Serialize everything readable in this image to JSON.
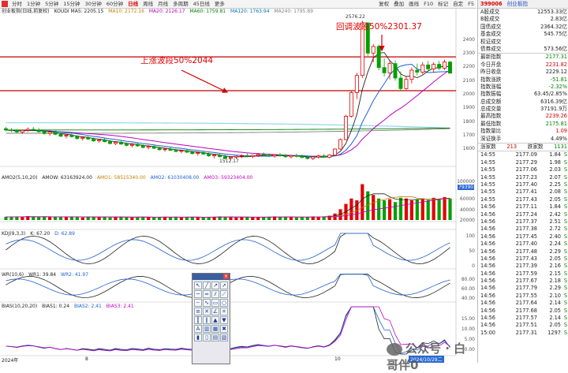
{
  "toolbar": {
    "periods": [
      "分时",
      "1分钟",
      "5分钟",
      "15分钟",
      "30分钟",
      "60分钟",
      "日线",
      "周线",
      "月线",
      "多周期",
      "45日线",
      "更多"
    ],
    "active_index": 6,
    "tools": [
      "复权",
      "叠加",
      "画线",
      "F10",
      "标记",
      "-",
      "自定",
      "F5"
    ],
    "f10": "F10"
  },
  "main_legend": {
    "title": "创业板指(日线,前复权)",
    "ma_header": "KOUDI MA5: 2205.15",
    "ma10": "MA10: 2172.16",
    "ma20": "MA20: 2126.17",
    "ma60": "MA60: 1759.81",
    "ma120": "MA120: 1763.94",
    "ma240": "MA240: 1795.89"
  },
  "annotations": {
    "up_wave": "上涨波段50%2044",
    "pullback": "回调波段50%2301.37",
    "high_label": "2576.22",
    "low_label": "1512.17"
  },
  "main_axis": [
    "2400",
    "2300",
    "2200",
    "2100",
    "2000",
    "1900",
    "1800",
    "1700",
    "1600"
  ],
  "vol_legend": {
    "a": "AMO2(5,10,20)",
    "b": "AMOW: 63163924.00",
    "c": "AMO1: 58515340.00",
    "d": "AMO2: 61030408.00",
    "e": "AMO3: 59323404.00",
    "box": "79390"
  },
  "vol_axis": [
    "100000",
    "80000",
    "60000",
    "40000",
    "20000"
  ],
  "kdj_legend": {
    "a": "KDJ(9,3,3)",
    "k": "K: 67.20",
    "d": "D: 62.89"
  },
  "kdj_axis": [
    "100",
    "50",
    "0"
  ],
  "wr_legend": {
    "a": "WR(10,6)",
    "b": "WR1: 39.84",
    "c": "WR2: 41.97"
  },
  "wr_axis": [
    "80.00",
    "60.00",
    "40.00"
  ],
  "bias_legend": {
    "a": "BIAS(10,20,20)",
    "b": "BIAS1: 0.24",
    "c": "BIAS2: 2.41",
    "d": "BIAS3: 2.41"
  },
  "bias_axis": [
    "15.00",
    "10.00",
    "5.00",
    "0.00",
    "-5.00"
  ],
  "date_axis": {
    "left": "2024年",
    "m1": "8",
    "m2": "10",
    "right": "2024/10/29二"
  },
  "watermark": "公众号 · 白哥伴0",
  "right_panel": {
    "code": "399006",
    "name": "创业板指",
    "stats": [
      {
        "label": "A股成交",
        "value": "12553.33亿",
        "cls": ""
      },
      {
        "label": "B股成交",
        "value": "2.83亿",
        "cls": ""
      },
      {
        "label": "国债成交",
        "value": "2364.32亿",
        "cls": ""
      },
      {
        "label": "基金成交",
        "value": "545.75亿",
        "cls": ""
      },
      {
        "label": "权证成交",
        "value": "",
        "cls": ""
      },
      {
        "label": "债券成交",
        "value": "573.56亿",
        "cls": ""
      }
    ],
    "quote": [
      {
        "label": "最新指数",
        "value": "2177.31",
        "cls": "green"
      },
      {
        "label": "今日开盘",
        "value": "2231.82",
        "cls": "red"
      },
      {
        "label": "昨日收盘",
        "value": "2229.12",
        "cls": ""
      },
      {
        "label": "指数涨跌",
        "value": "-51.81",
        "cls": "green"
      },
      {
        "label": "指数涨幅",
        "value": "-2.32%",
        "cls": "green"
      },
      {
        "label": "指数振幅",
        "value": "63.45/2.85%",
        "cls": ""
      },
      {
        "label": "总成交额",
        "value": "6316.39亿",
        "cls": ""
      },
      {
        "label": "总成交量",
        "value": "37191.9万",
        "cls": ""
      },
      {
        "label": "最高指数",
        "value": "2239.26",
        "cls": "red"
      },
      {
        "label": "最低指数",
        "value": "2175.81",
        "cls": "green"
      },
      {
        "label": "指数量比",
        "value": "1.09",
        "cls": "red"
      },
      {
        "label": "深证换手",
        "value": "4.49%",
        "cls": ""
      }
    ],
    "updown": {
      "up_label": "涨家数",
      "up": "213",
      "down_label": "跌家数",
      "down": "1131"
    },
    "ticks": [
      {
        "t": "14:55",
        "p": "2177.09",
        "v": "1.84"
      },
      {
        "t": "14:55",
        "p": "2177.29",
        "v": "1.98"
      },
      {
        "t": "14:55",
        "p": "2177.06",
        "v": "2.03"
      },
      {
        "t": "14:55",
        "p": "2177.23",
        "v": "2.07"
      },
      {
        "t": "14:55",
        "p": "2177.40",
        "v": "2.25"
      },
      {
        "t": "14:55",
        "p": "2177.41",
        "v": "2.08"
      },
      {
        "t": "14:55",
        "p": "2177.43",
        "v": "2.05"
      },
      {
        "t": "14:56",
        "p": "2177.11",
        "v": "1.84"
      },
      {
        "t": "14:56",
        "p": "2177.24",
        "v": "2.42"
      },
      {
        "t": "14:56",
        "p": "2177.37",
        "v": "2.51"
      },
      {
        "t": "14:56",
        "p": "2177.38",
        "v": "2.72"
      },
      {
        "t": "14:56",
        "p": "2177.45",
        "v": "2.40"
      },
      {
        "t": "14:56",
        "p": "2177.40",
        "v": "2.24"
      },
      {
        "t": "14:56",
        "p": "2177.48",
        "v": "2.29"
      },
      {
        "t": "14:56",
        "p": "2177.43",
        "v": "2.05"
      },
      {
        "t": "14:56",
        "p": "2177.39",
        "v": "2.16"
      },
      {
        "t": "14:56",
        "p": "2177.59",
        "v": "2.15"
      },
      {
        "t": "14:56",
        "p": "2177.67",
        "v": "2.18"
      },
      {
        "t": "14:56",
        "p": "2177.79",
        "v": "2.29"
      },
      {
        "t": "14:56",
        "p": "2177.55",
        "v": "2.10"
      },
      {
        "t": "14:56",
        "p": "2177.64",
        "v": "2.14"
      },
      {
        "t": "14:56",
        "p": "2177.68",
        "v": "2.05"
      },
      {
        "t": "14:56",
        "p": "2177.57",
        "v": "2.14"
      },
      {
        "t": "14:56",
        "p": "2177.51",
        "v": "2.05"
      },
      {
        "t": "15:00",
        "p": "2177.31",
        "v": "1297"
      }
    ]
  },
  "chart_data": {
    "type": "candlestick",
    "title": "创业板指(日线,前复权)",
    "ylim": [
      1480,
      2620
    ],
    "ohlc": [
      [
        1755,
        1770,
        1735,
        1745
      ],
      [
        1745,
        1760,
        1728,
        1740
      ],
      [
        1740,
        1752,
        1720,
        1730
      ],
      [
        1730,
        1748,
        1715,
        1742
      ],
      [
        1742,
        1765,
        1730,
        1750
      ],
      [
        1750,
        1768,
        1738,
        1745
      ],
      [
        1745,
        1760,
        1725,
        1732
      ],
      [
        1732,
        1745,
        1710,
        1718
      ],
      [
        1718,
        1735,
        1700,
        1728
      ],
      [
        1728,
        1740,
        1705,
        1712
      ],
      [
        1712,
        1725,
        1690,
        1698
      ],
      [
        1698,
        1712,
        1680,
        1705
      ],
      [
        1705,
        1718,
        1688,
        1694
      ],
      [
        1694,
        1706,
        1672,
        1680
      ],
      [
        1680,
        1695,
        1665,
        1688
      ],
      [
        1688,
        1700,
        1670,
        1676
      ],
      [
        1676,
        1688,
        1655,
        1662
      ],
      [
        1662,
        1678,
        1648,
        1670
      ],
      [
        1670,
        1682,
        1650,
        1656
      ],
      [
        1656,
        1668,
        1635,
        1642
      ],
      [
        1642,
        1660,
        1630,
        1652
      ],
      [
        1652,
        1664,
        1632,
        1638
      ],
      [
        1638,
        1650,
        1620,
        1628
      ],
      [
        1628,
        1645,
        1612,
        1635
      ],
      [
        1635,
        1648,
        1618,
        1624
      ],
      [
        1624,
        1636,
        1605,
        1612
      ],
      [
        1612,
        1628,
        1598,
        1620
      ],
      [
        1620,
        1632,
        1600,
        1606
      ],
      [
        1606,
        1618,
        1588,
        1595
      ],
      [
        1595,
        1610,
        1580,
        1600
      ],
      [
        1600,
        1612,
        1584,
        1590
      ],
      [
        1590,
        1604,
        1575,
        1582
      ],
      [
        1582,
        1596,
        1568,
        1588
      ],
      [
        1588,
        1600,
        1570,
        1576
      ],
      [
        1576,
        1588,
        1558,
        1566
      ],
      [
        1566,
        1580,
        1550,
        1572
      ],
      [
        1572,
        1586,
        1556,
        1562
      ],
      [
        1562,
        1574,
        1540,
        1548
      ],
      [
        1548,
        1562,
        1530,
        1555
      ],
      [
        1555,
        1568,
        1536,
        1542
      ],
      [
        1542,
        1556,
        1520,
        1530
      ],
      [
        1530,
        1546,
        1512,
        1538
      ],
      [
        1538,
        1552,
        1524,
        1545
      ],
      [
        1545,
        1560,
        1532,
        1550
      ],
      [
        1550,
        1566,
        1538,
        1543
      ],
      [
        1543,
        1558,
        1530,
        1552
      ],
      [
        1552,
        1570,
        1540,
        1560
      ],
      [
        1560,
        1575,
        1546,
        1553
      ],
      [
        1553,
        1566,
        1538,
        1547
      ],
      [
        1547,
        1562,
        1533,
        1556
      ],
      [
        1556,
        1570,
        1542,
        1549
      ],
      [
        1549,
        1562,
        1534,
        1541
      ],
      [
        1541,
        1556,
        1528,
        1550
      ],
      [
        1550,
        1565,
        1536,
        1544
      ],
      [
        1544,
        1558,
        1530,
        1536
      ],
      [
        1536,
        1550,
        1520,
        1528
      ],
      [
        1528,
        1545,
        1516,
        1540
      ],
      [
        1540,
        1556,
        1528,
        1548
      ],
      [
        1548,
        1562,
        1532,
        1538
      ],
      [
        1538,
        1560,
        1530,
        1554
      ],
      [
        1554,
        1605,
        1550,
        1600
      ],
      [
        1600,
        1680,
        1595,
        1672
      ],
      [
        1672,
        1860,
        1668,
        1850
      ],
      [
        1850,
        2040,
        1840,
        2030
      ],
      [
        2030,
        2180,
        1980,
        2160
      ],
      [
        2160,
        2576,
        2140,
        2560
      ],
      [
        2560,
        2420,
        2310,
        2330
      ],
      [
        2330,
        2400,
        2260,
        2380
      ],
      [
        2380,
        2395,
        2200,
        2220
      ],
      [
        2220,
        2290,
        2150,
        2180
      ],
      [
        2180,
        2270,
        2130,
        2250
      ],
      [
        2250,
        2275,
        2120,
        2140
      ],
      [
        2140,
        2190,
        2040,
        2060
      ],
      [
        2060,
        2150,
        2050,
        2130
      ],
      [
        2130,
        2220,
        2100,
        2200
      ],
      [
        2200,
        2250,
        2160,
        2185
      ],
      [
        2185,
        2260,
        2170,
        2240
      ],
      [
        2240,
        2270,
        2190,
        2210
      ],
      [
        2210,
        2260,
        2180,
        2245
      ],
      [
        2245,
        2270,
        2200,
        2215
      ],
      [
        2215,
        2280,
        2200,
        2262
      ],
      [
        2262,
        2270,
        2175,
        2177
      ]
    ],
    "volume": [
      9,
      8,
      10,
      9,
      11,
      8,
      9,
      10,
      8,
      9,
      8,
      9,
      10,
      8,
      7,
      9,
      8,
      8,
      9,
      7,
      8,
      9,
      8,
      7,
      8,
      9,
      8,
      7,
      8,
      9,
      8,
      9,
      7,
      8,
      9,
      8,
      7,
      8,
      9,
      10,
      9,
      8,
      7,
      8,
      9,
      8,
      7,
      8,
      9,
      10,
      8,
      9,
      8,
      7,
      9,
      8,
      10,
      9,
      10,
      12,
      18,
      30,
      45,
      60,
      55,
      100,
      80,
      70,
      60,
      55,
      58,
      50,
      62,
      60,
      55,
      58,
      60,
      56,
      62,
      58,
      64,
      60
    ],
    "levels": {
      "up_wave_50": 2044,
      "pullback_50": 2301.37,
      "high": 2576.22,
      "low": 1512.17
    }
  }
}
